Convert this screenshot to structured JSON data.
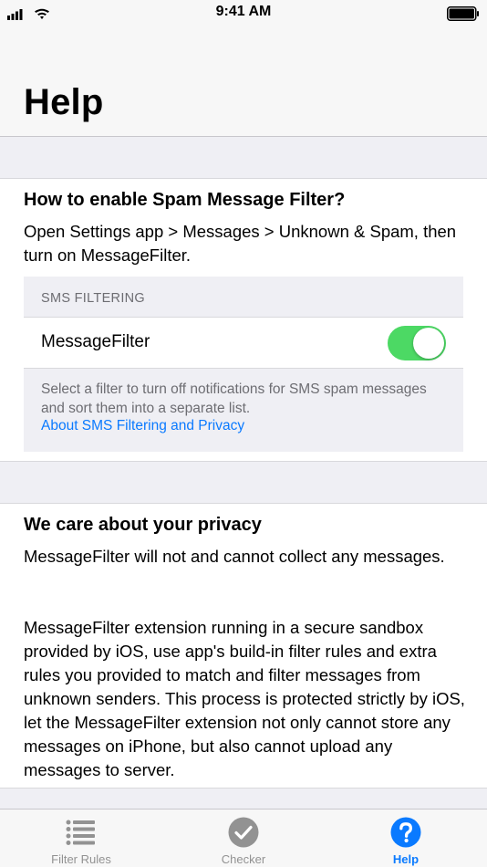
{
  "status_bar": {
    "time": "9:41 AM"
  },
  "nav": {
    "title": "Help"
  },
  "enable_section": {
    "heading": "How to enable Spam Message Filter?",
    "instructions": "Open Settings app > Messages > Unknown & Spam, then turn on MessageFilter.",
    "settings_preview": {
      "header": "SMS FILTERING",
      "row_label": "MessageFilter",
      "toggle_on": true,
      "footer": "Select a filter to turn off notifications for SMS spam messages and sort them into a separate list.",
      "link": "About SMS Filtering and Privacy"
    }
  },
  "privacy_section": {
    "heading": "We care about your privacy",
    "paragraph_1": "MessageFilter will not and cannot collect any messages.",
    "paragraph_2": "MessageFilter extension running in a secure sandbox provided by iOS, use app's build-in filter rules and extra rules you provided to match and filter messages from unknown senders. This process is protected strictly by iOS, let the MessageFilter extension not only cannot store any messages on iPhone, but also cannot upload any messages to server."
  },
  "tab_bar": {
    "tabs": [
      {
        "label": "Filter Rules",
        "icon": "list-icon",
        "active": false
      },
      {
        "label": "Checker",
        "icon": "checkmark-circle-icon",
        "active": false
      },
      {
        "label": "Help",
        "icon": "question-circle-icon",
        "active": true
      }
    ]
  },
  "colors": {
    "accent": "#0a7aff",
    "toggle_on": "#4cd964",
    "inactive_tab": "#929292"
  }
}
